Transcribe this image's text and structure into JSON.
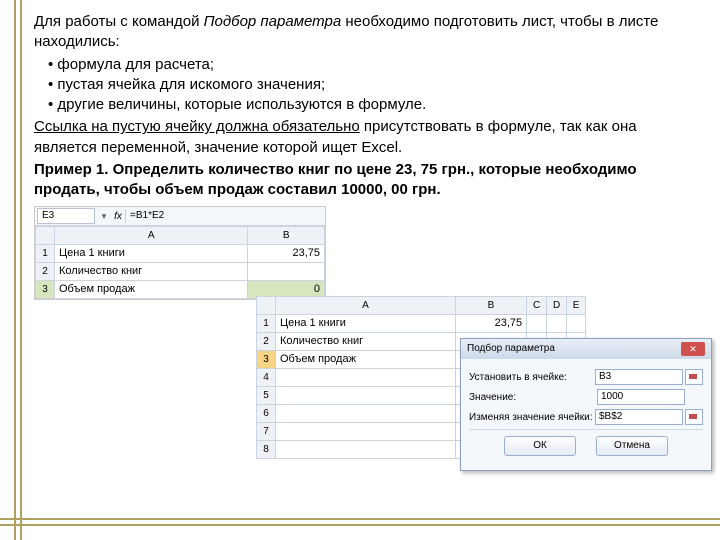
{
  "text": {
    "intro1a": "Для работы с командой ",
    "intro1b": "Подбор параметра",
    "intro1c": " необходимо подготовить лист, чтобы в листе находились:",
    "b1": "формула для расчета;",
    "b2": "пустая ячейка для искомого значения;",
    "b3": "другие величины, которые используются в формуле.",
    "note_u": "Ссылка на пустую ячейку должна обязательно",
    "note_rest": " присутствовать в формуле, так как она является переменной, значение которой ищет Excel.",
    "example": "Пример 1. Определить количество книг по цене 23, 75 грн., которые необходимо продать, чтобы объем продаж составил 10000, 00 грн."
  },
  "sheet": {
    "namebox": "E3",
    "formula": "=B1*E2",
    "colA": "A",
    "colB": "B",
    "colC": "C",
    "colD": "D",
    "colE": "E",
    "row1": "1",
    "row2": "2",
    "row3": "3",
    "row4": "4",
    "row5": "5",
    "row6": "6",
    "row7": "7",
    "row8": "8",
    "label_price": "Цена 1 книги",
    "label_qty": "Количество книг",
    "label_sales": "Объем продаж",
    "val_price": "23,75",
    "val_qty": "",
    "val_sales": "0"
  },
  "dialog": {
    "title": "Подбор параметра",
    "f_setcell": "Установить в ячейке:",
    "f_value": "Значение:",
    "f_change": "Изменяя значение ячейки:",
    "v_setcell": "B3",
    "v_value": "1000",
    "v_change": "$B$2",
    "ok": "ОК",
    "cancel": "Отмена"
  }
}
